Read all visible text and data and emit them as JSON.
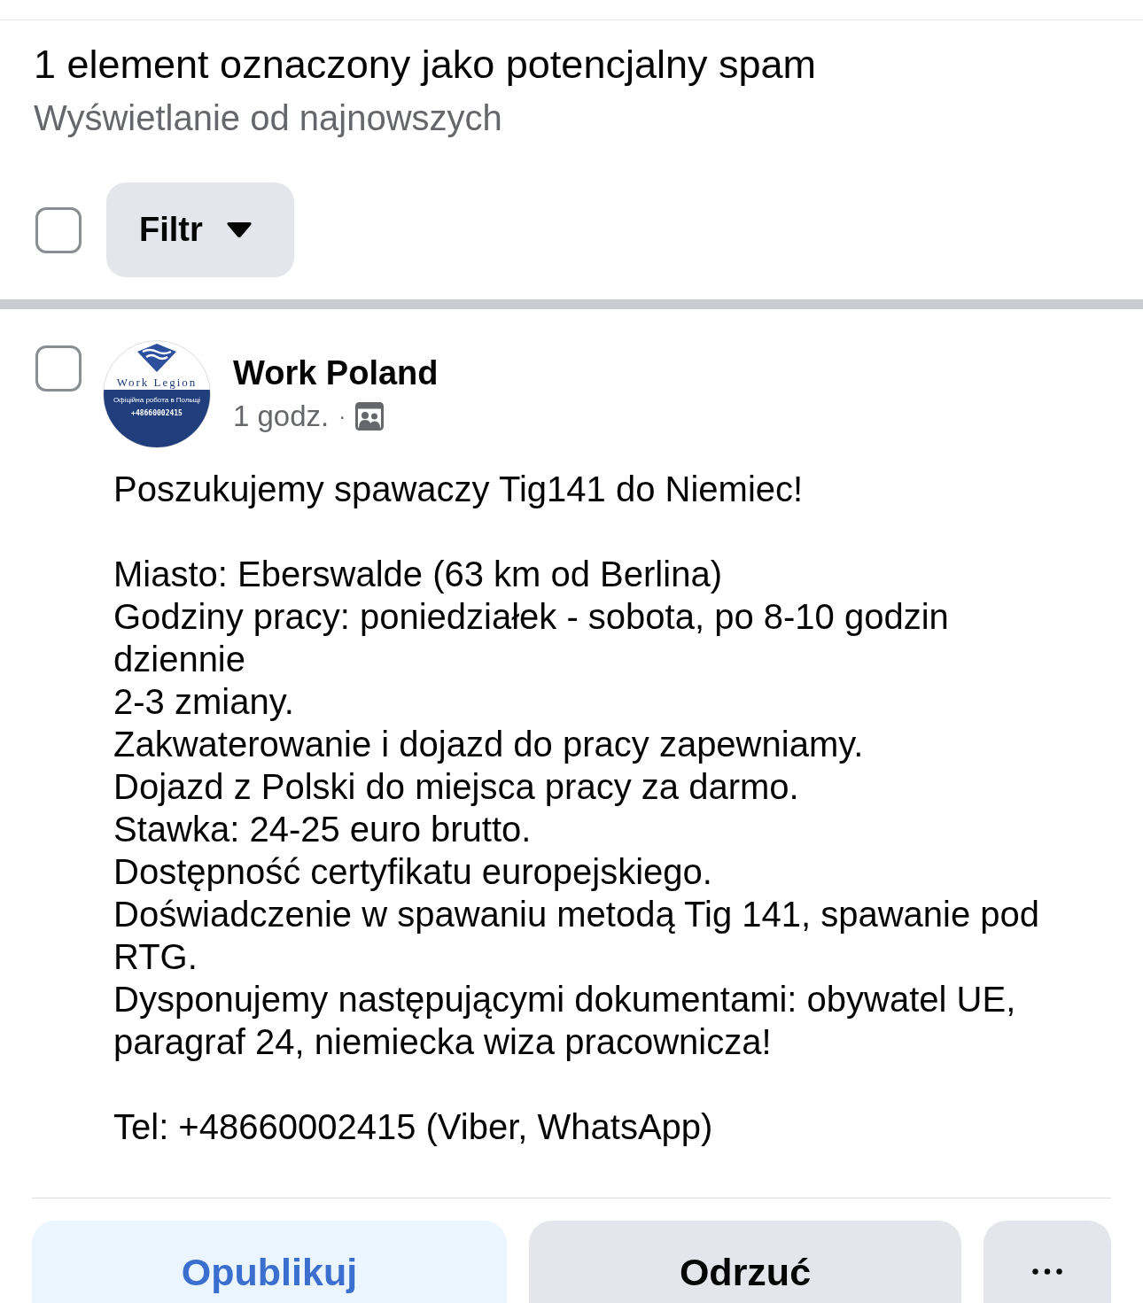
{
  "header": {
    "title": "1 element oznaczony jako potencjalny spam",
    "subtitle": "Wyświetlanie od najnowszych"
  },
  "toolbar": {
    "select_all": {
      "checked": false
    },
    "filter_button": {
      "label": "Filtr"
    }
  },
  "post": {
    "checked": false,
    "avatar": {
      "logo_name": "Work Legion",
      "tagline": "Офіційна робота в Польщі",
      "phone": "+48660002415"
    },
    "author": "Work Poland",
    "time": "1 godz.",
    "separator": "·",
    "body": [
      [
        "Poszukujemy spawaczy Tig141 do Niemiec!"
      ],
      [
        "Miasto: Eberswalde (63 km od Berlina)",
        "Godziny pracy: poniedziałek - sobota, po 8-10 godzin dziennie",
        "2-3 zmiany.",
        "Zakwaterowanie i dojazd do pracy zapewniamy.",
        "Dojazd z Polski do miejsca pracy za darmo.",
        "Stawka: 24-25 euro brutto.",
        "Dostępność certyfikatu europejskiego.",
        "Doświadczenie w spawaniu metodą Tig 141, spawanie pod RTG.",
        "Dysponujemy następującymi dokumentami: obywatel UE, paragraf 24, niemiecka wiza pracownicza!"
      ],
      [
        "Tel: +48660002415 (Viber, WhatsApp)"
      ]
    ]
  },
  "actions": [
    {
      "kind": "primary",
      "label": "Opublikuj"
    },
    {
      "kind": "secondary",
      "label": "Odrzuć"
    },
    {
      "kind": "more"
    }
  ]
}
